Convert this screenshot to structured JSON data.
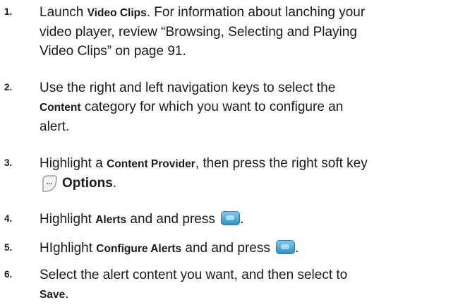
{
  "steps": [
    {
      "number": "1.",
      "line1_a": "Launch ",
      "line1_bold": "Video Clips",
      "line1_b": ". For information about lanching your",
      "line2": "video player, review “Browsing, Selecting and Playing",
      "line3": "Video Clips” on page 91."
    },
    {
      "number": "2.",
      "line1": "Use the right and left navigation keys to select the",
      "line2_bold": "Content",
      "line2_b": " category for which you want to configure an",
      "line3": "alert."
    },
    {
      "number": "3.",
      "line1_a": "Highlight a ",
      "line1_bold": "Content Provider",
      "line1_b": ", then press the right soft key",
      "line2_bold": "Options",
      "line2_b": "."
    },
    {
      "number": "4.",
      "text_a": "Highlight ",
      "text_bold": "Alerts",
      "text_b": " and and press ",
      "text_c": "."
    },
    {
      "number": "5.",
      "text_a": "HIghlight ",
      "text_bold": "Configure Alerts",
      "text_b": " and and press ",
      "text_c": "."
    },
    {
      "number": "6.",
      "line1": "Select the alert content you want, and then select to",
      "line2_bold": "Save",
      "line2_b": "."
    }
  ],
  "icons": {
    "ok_key": "ok-key-icon",
    "soft_key": "right-soft-key-icon"
  },
  "colors": {
    "text": "#1a1a1a",
    "ok_key_blue": "#2b93c9"
  }
}
